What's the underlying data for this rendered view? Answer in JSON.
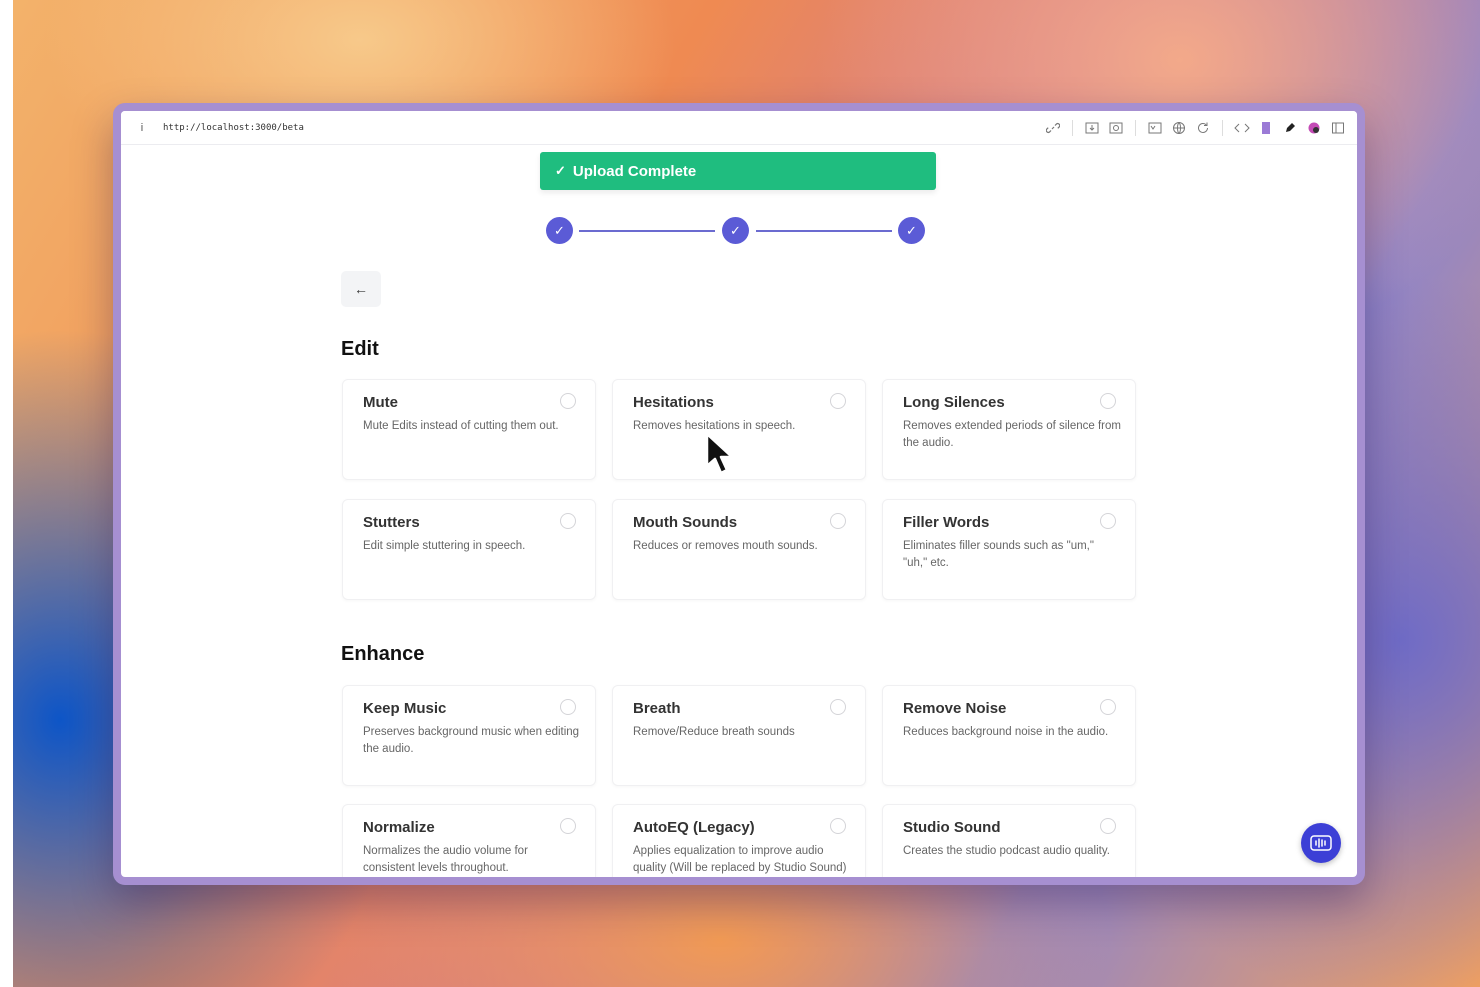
{
  "browser": {
    "info_icon": "info-icon",
    "url": "http://localhost:3000/beta",
    "toolbar_icons": [
      "link-icon",
      "download-icon",
      "screenshot-icon",
      "reader-icon",
      "globe-icon",
      "refresh-icon",
      "code-icon",
      "bookmark-icon",
      "pen-icon",
      "extension-icon",
      "sidebar-icon"
    ]
  },
  "toast": {
    "icon": "checkmark-icon",
    "message": "Upload Complete",
    "color": "#1fbd7f"
  },
  "stepper": {
    "steps_completed": 3,
    "steps_total": 3,
    "accent": "#5b5bd6"
  },
  "back_button": {
    "icon": "arrow-left-icon",
    "label": "←"
  },
  "sections": [
    {
      "title": "Edit",
      "options": [
        {
          "title": "Mute",
          "description": "Mute Edits instead of cutting them out."
        },
        {
          "title": "Hesitations",
          "description": "Removes hesitations in speech."
        },
        {
          "title": "Long Silences",
          "description": "Removes extended periods of silence from the audio."
        },
        {
          "title": "Stutters",
          "description": "Edit simple stuttering in speech."
        },
        {
          "title": "Mouth Sounds",
          "description": "Reduces or removes mouth sounds."
        },
        {
          "title": "Filler Words",
          "description": "Eliminates filler sounds such as \"um,\" \"uh,\" etc."
        }
      ]
    },
    {
      "title": "Enhance",
      "options": [
        {
          "title": "Keep Music",
          "description": "Preserves background music when editing the audio."
        },
        {
          "title": "Breath",
          "description": "Remove/Reduce breath sounds"
        },
        {
          "title": "Remove Noise",
          "description": "Reduces background noise in the audio."
        },
        {
          "title": "Normalize",
          "description": "Normalizes the audio volume for consistent levels throughout."
        },
        {
          "title": "AutoEQ (Legacy)",
          "description": "Applies equalization to improve audio quality (Will be replaced by Studio Sound)"
        },
        {
          "title": "Studio Sound",
          "description": "Creates the studio podcast audio quality."
        }
      ]
    }
  ],
  "fab": {
    "icon": "audio-waveform-icon"
  }
}
